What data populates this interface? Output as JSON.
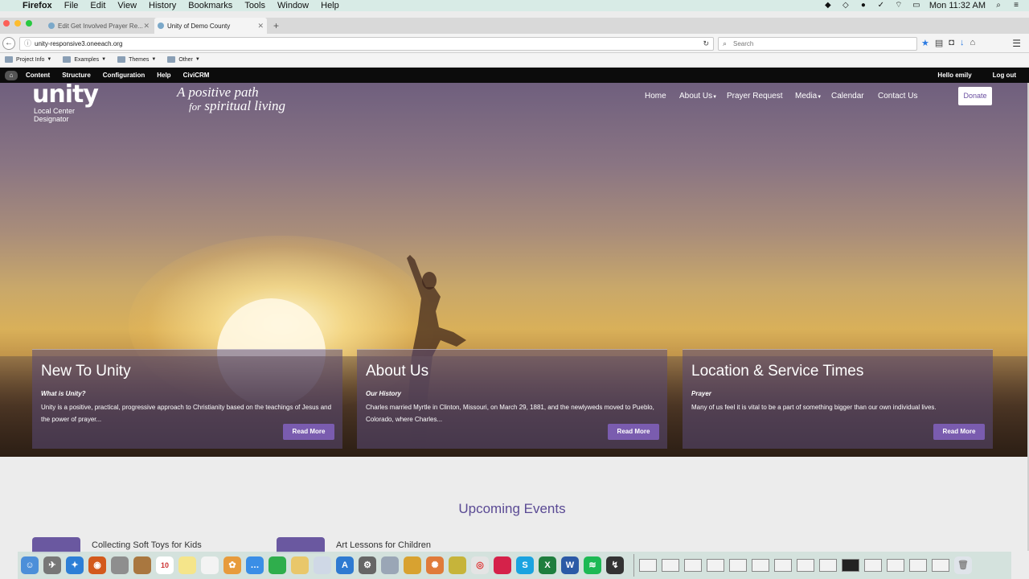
{
  "menubar": {
    "items": [
      "Firefox",
      "File",
      "Edit",
      "View",
      "History",
      "Bookmarks",
      "Tools",
      "Window",
      "Help"
    ],
    "clock": "Mon 11:32 AM",
    "status_icons": [
      "malwarebytes-icon",
      "dropbox-icon",
      "evernote-icon",
      "vpn-check-icon",
      "wifi-icon",
      "battery-icon",
      "spotlight-icon",
      "notification-center-icon"
    ]
  },
  "tabs": [
    {
      "title": "Edit Get Involved Prayer Re...",
      "active": false
    },
    {
      "title": "Unity of Demo County",
      "active": true
    }
  ],
  "navbar": {
    "url": "unity-responsive3.oneeach.org",
    "search_placeholder": "Search"
  },
  "bookmarks": [
    "Project Info",
    "Examples",
    "Themes",
    "Other"
  ],
  "admin": {
    "items": [
      "Content",
      "Structure",
      "Configuration",
      "Help",
      "CiviCRM"
    ],
    "greeting": "Hello emily",
    "logout": "Log out"
  },
  "site": {
    "logo_word": "unity",
    "logo_sub1": "Local Center",
    "logo_sub2": "Designator",
    "tagline_l1": "A positive path",
    "tagline_l2_prefix": "for",
    "tagline_l2": "spiritual living",
    "nav": [
      {
        "label": "Home",
        "dropdown": false
      },
      {
        "label": "About Us",
        "dropdown": true
      },
      {
        "label": "Prayer Request",
        "dropdown": false
      },
      {
        "label": "Media",
        "dropdown": true
      },
      {
        "label": "Calendar",
        "dropdown": false
      },
      {
        "label": "Contact Us",
        "dropdown": false
      }
    ],
    "donate": "Donate"
  },
  "cards": [
    {
      "title": "New To Unity",
      "subtitle": "What is Unity?",
      "body": "Unity is a positive, practical, progressive approach to Christianity based on the teachings of Jesus and the power of prayer...",
      "button": "Read More"
    },
    {
      "title": "About Us",
      "subtitle": "Our History",
      "body": "Charles married Myrtle in Clinton, Missouri, on March 29, 1881, and the newlyweds moved to Pueblo, Colorado, where Charles...",
      "button": "Read More"
    },
    {
      "title": "Location & Service Times",
      "subtitle": "Prayer",
      "body": "Many of us feel it is vital to be a part of something bigger than our own individual lives.",
      "button": "Read More"
    }
  ],
  "events": {
    "title": "Upcoming Events",
    "items": [
      "Collecting Soft Toys for Kids",
      "Art Lessons for Children"
    ]
  },
  "dock": {
    "calendar_day": "10",
    "skype_letter": "S",
    "excel_letter": "X",
    "word_letter": "W"
  }
}
